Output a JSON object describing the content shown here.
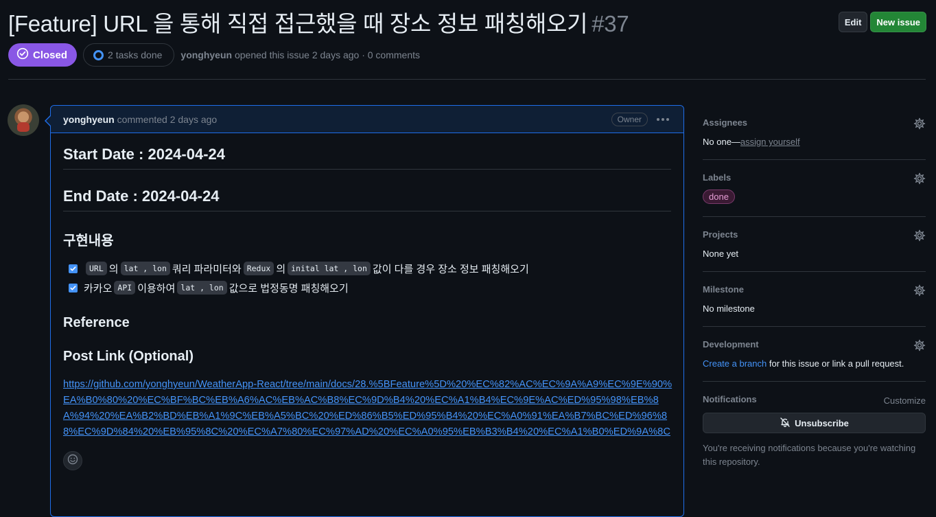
{
  "issue": {
    "title": "[Feature] URL 을 통해 직접 접근했을 때 장소 정보 패칭해오기",
    "number": "#37",
    "state": "Closed",
    "tasks": "2 tasks done",
    "author": "yonghyeun",
    "opened_text": " opened this issue 2 days ago · 0 comments"
  },
  "header": {
    "edit_label": "Edit",
    "new_issue_label": "New issue"
  },
  "comment": {
    "author": "yonghyeun",
    "time_text": "commented 2 days ago",
    "role_badge": "Owner",
    "start_date": "Start Date : 2024-04-24",
    "end_date": "End Date : 2024-04-24",
    "impl_heading": "구현내용",
    "task1": {
      "code1": "URL",
      "t1": "의",
      "code2": "lat , lon",
      "t2": "쿼리 파라미터와",
      "code3": "Redux",
      "t3": "의",
      "code4": "inital lat , lon",
      "t4": "값이 다를 경우 장소 정보 패칭해오기"
    },
    "task2": {
      "t1": "카카오",
      "code1": "API",
      "t2": "이용하여",
      "code2": "lat , lon",
      "t3": "값으로 법정동명 패칭해오기"
    },
    "reference_heading": "Reference",
    "post_link_heading": "Post Link (Optional)",
    "post_link_url": "https://github.com/yonghyeun/WeatherApp-React/tree/main/docs/28.%5BFeature%5D%20%EC%82%AC%EC%9A%A9%EC%9E%90%EA%B0%80%20%EC%BF%BC%EB%A6%AC%EB%AC%B8%EC%9D%B4%20%EC%A1%B4%EC%9E%AC%ED%95%98%EB%8A%94%20%EA%B2%BD%EB%A1%9C%EB%A5%BC%20%ED%86%B5%ED%95%B4%20%EC%A0%91%EA%B7%BC%ED%96%88%EC%9D%84%20%EB%95%8C%20%EC%A7%80%EC%97%AD%20%EC%A0%95%EB%B3%B4%20%EC%A1%B0%ED%9A%8C"
  },
  "sidebar": {
    "assignees_title": "Assignees",
    "assignees_value": "No one—",
    "assign_yourself": "assign yourself",
    "labels_title": "Labels",
    "label_done": "done",
    "projects_title": "Projects",
    "projects_value": "None yet",
    "milestone_title": "Milestone",
    "milestone_value": "No milestone",
    "development_title": "Development",
    "create_branch": "Create a branch",
    "development_rest": " for this issue or link a pull request.",
    "notifications_title": "Notifications",
    "customize": "Customize",
    "unsubscribe": "Unsubscribe",
    "notif_note": "You're receiving notifications because you're watching this repository."
  },
  "colors": {
    "closed": "#8957e5",
    "link": "#4493f8",
    "primary": "#238636"
  }
}
